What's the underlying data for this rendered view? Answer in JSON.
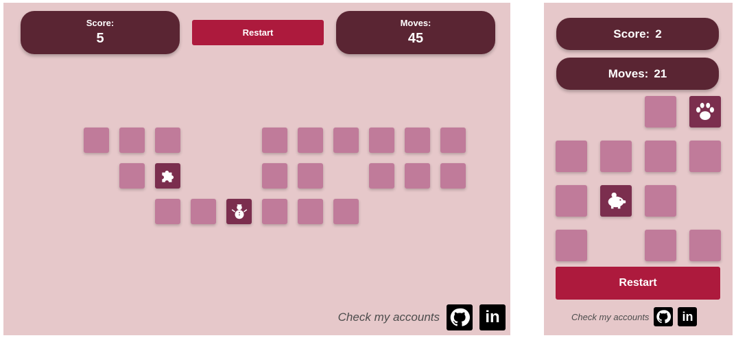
{
  "desktop": {
    "score_label": "Score:",
    "score_value": "5",
    "moves_label": "Moves:",
    "moves_value": "45",
    "restart_label": "Restart",
    "footer_text": "Check my accounts",
    "cards": [
      {
        "row": 0,
        "col": 0,
        "state": "closed"
      },
      {
        "row": 0,
        "col": 1,
        "state": "closed"
      },
      {
        "row": 0,
        "col": 2,
        "state": "closed"
      },
      {
        "row": 0,
        "col": 5,
        "state": "closed"
      },
      {
        "row": 0,
        "col": 6,
        "state": "closed"
      },
      {
        "row": 0,
        "col": 7,
        "state": "closed"
      },
      {
        "row": 0,
        "col": 8,
        "state": "closed"
      },
      {
        "row": 0,
        "col": 9,
        "state": "closed"
      },
      {
        "row": 0,
        "col": 10,
        "state": "closed"
      },
      {
        "row": 1,
        "col": 1,
        "state": "closed"
      },
      {
        "row": 1,
        "col": 2,
        "state": "open",
        "icon": "puzzle-piece-icon"
      },
      {
        "row": 1,
        "col": 5,
        "state": "closed"
      },
      {
        "row": 1,
        "col": 6,
        "state": "closed"
      },
      {
        "row": 1,
        "col": 8,
        "state": "closed"
      },
      {
        "row": 1,
        "col": 9,
        "state": "closed"
      },
      {
        "row": 1,
        "col": 10,
        "state": "closed"
      },
      {
        "row": 2,
        "col": 2,
        "state": "closed"
      },
      {
        "row": 2,
        "col": 3,
        "state": "closed"
      },
      {
        "row": 2,
        "col": 4,
        "state": "open",
        "icon": "snowman-icon"
      },
      {
        "row": 2,
        "col": 5,
        "state": "closed"
      },
      {
        "row": 2,
        "col": 6,
        "state": "closed"
      },
      {
        "row": 2,
        "col": 7,
        "state": "closed"
      }
    ]
  },
  "mobile": {
    "score_label": "Score:",
    "score_value": "2",
    "moves_label": "Moves:",
    "moves_value": "21",
    "restart_label": "Restart",
    "footer_text": "Check my accounts",
    "cards": [
      {
        "row": 0,
        "col": 2,
        "state": "closed"
      },
      {
        "row": 0,
        "col": 3,
        "state": "open",
        "icon": "paw-icon"
      },
      {
        "row": 1,
        "col": 0,
        "state": "closed"
      },
      {
        "row": 1,
        "col": 1,
        "state": "closed"
      },
      {
        "row": 1,
        "col": 2,
        "state": "closed"
      },
      {
        "row": 1,
        "col": 3,
        "state": "closed"
      },
      {
        "row": 2,
        "col": 0,
        "state": "closed"
      },
      {
        "row": 2,
        "col": 1,
        "state": "open",
        "icon": "piggy-bank-icon"
      },
      {
        "row": 2,
        "col": 2,
        "state": "closed"
      },
      {
        "row": 3,
        "col": 0,
        "state": "closed"
      },
      {
        "row": 3,
        "col": 2,
        "state": "closed"
      },
      {
        "row": 3,
        "col": 3,
        "state": "closed"
      }
    ]
  },
  "social": [
    {
      "icon": "github-icon"
    },
    {
      "icon": "linkedin-icon"
    }
  ]
}
